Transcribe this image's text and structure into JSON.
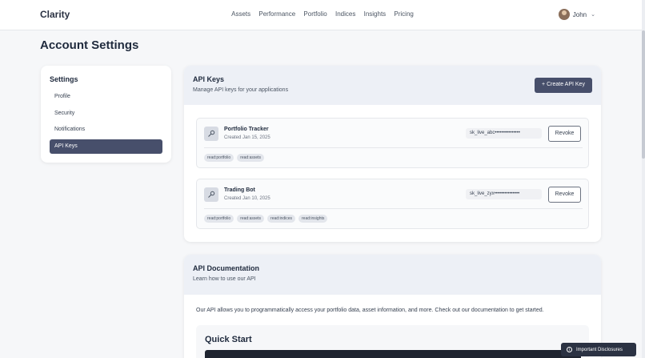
{
  "header": {
    "brand": "Clarity",
    "nav": [
      "Assets",
      "Performance",
      "Portfolio",
      "Indices",
      "Insights",
      "Pricing"
    ],
    "user_name": "John"
  },
  "page": {
    "title": "Account Settings"
  },
  "sidebar": {
    "title": "Settings",
    "items": [
      {
        "label": "Profile",
        "active": false
      },
      {
        "label": "Security",
        "active": false
      },
      {
        "label": "Notifications",
        "active": false
      },
      {
        "label": "API Keys",
        "active": true
      }
    ]
  },
  "api_keys": {
    "title": "API Keys",
    "subtitle": "Manage API keys for your applications",
    "create_label": "+ Create API Key",
    "revoke_label": "Revoke",
    "keys": [
      {
        "name": "Portfolio Tracker",
        "created": "Created Jan 15, 2025",
        "masked": "sk_live_abc•••••••••••••••",
        "scopes": [
          "read:portfolio",
          "read:assets"
        ]
      },
      {
        "name": "Trading Bot",
        "created": "Created Jan 10, 2025",
        "masked": "sk_live_zyx•••••••••••••••",
        "scopes": [
          "read:portfolio",
          "read:assets",
          "read:indices",
          "read:insights"
        ]
      }
    ]
  },
  "docs": {
    "title": "API Documentation",
    "subtitle": "Learn how to use our API",
    "body": "Our API allows you to programmatically access your portfolio data, asset information, and more. Check out our documentation to get started.",
    "quick_start": "Quick Start"
  },
  "disclosures": {
    "label": "Important Disclosures"
  }
}
